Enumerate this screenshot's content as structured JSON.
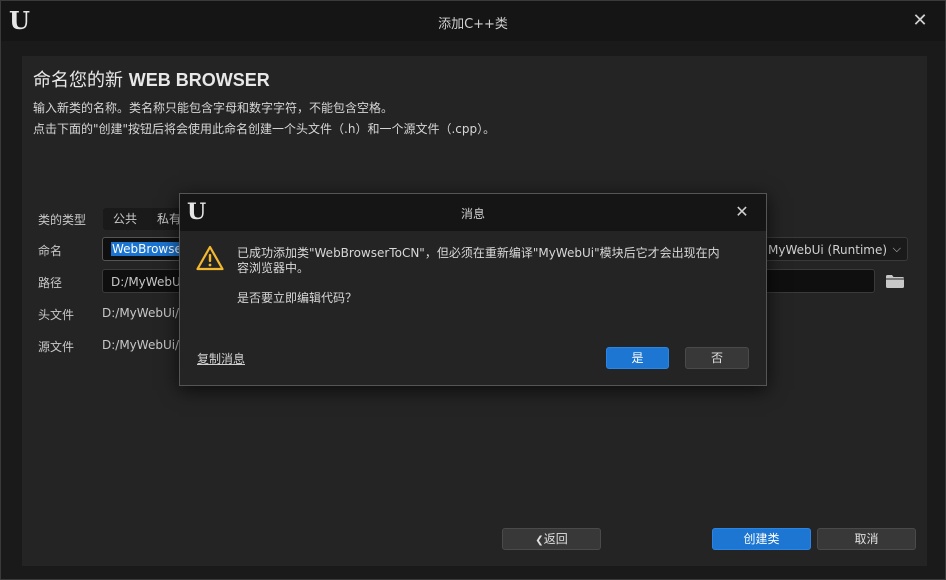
{
  "window": {
    "title": "添加C++类",
    "close_glyph": "✕",
    "logo_glyph": "U"
  },
  "header": {
    "title_prefix": "命名您的新",
    "title_class": "WEB BROWSER",
    "desc_line1": "输入新类的名称。类名称只能包含字母和数字字符，不能包含空格。",
    "desc_line2": "点击下面的\"创建\"按钮后将会使用此命名创建一个头文件（.h）和一个源文件（.cpp）。"
  },
  "form": {
    "class_type_label": "类的类型",
    "class_type_options": [
      "公共",
      "私有"
    ],
    "name_label": "命名",
    "name_value": "WebBrowse",
    "path_label": "路径",
    "path_value": "D:/MyWebU",
    "header_label": "头文件",
    "header_value": "D:/MyWebUi/",
    "source_label": "源文件",
    "source_value": "D:/MyWebUi/",
    "module_value": "MyWebUi (Runtime)",
    "module_chevron": "⌵"
  },
  "footer": {
    "back_label": "返回",
    "back_glyph": "❮",
    "create_label": "创建类",
    "cancel_label": "取消"
  },
  "modal": {
    "title": "消息",
    "close_glyph": "✕",
    "message_line1": "已成功添加类\"WebBrowserToCN\"，但必须在重新编译\"MyWebUi\"模块后它才会出现在内",
    "message_line2": "容浏览器中。",
    "question": "是否要立即编辑代码？",
    "copy_label": "复制消息",
    "yes_label": "是",
    "no_label": "否"
  },
  "colors": {
    "accent": "#1d76d2",
    "warning": "#f2b830"
  },
  "icons": [
    "unreal-logo-icon",
    "close-icon",
    "warning-icon",
    "folder-icon",
    "chevron-down-icon",
    "chevron-left-icon"
  ]
}
